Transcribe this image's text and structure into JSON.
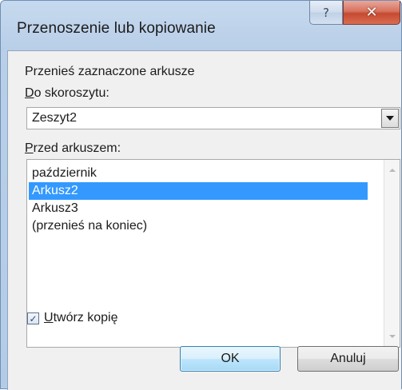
{
  "window": {
    "title": "Przenoszenie lub kopiowanie",
    "help_glyph": "?",
    "close_glyph": "✕"
  },
  "dialog": {
    "move_selected_label": "Przenieś zaznaczone arkusze",
    "to_book": {
      "label_mnemonic": "D",
      "label_rest": "o skoroszytu:",
      "value": "Zeszyt2"
    },
    "before_sheet": {
      "label_mnemonic": "P",
      "label_rest": "rzed arkuszem:",
      "items": [
        {
          "label": "październik",
          "selected": false
        },
        {
          "label": "Arkusz2",
          "selected": true
        },
        {
          "label": "Arkusz3",
          "selected": false
        },
        {
          "label": "(przenieś na koniec)",
          "selected": false
        }
      ]
    },
    "create_copy": {
      "checked": true,
      "check_glyph": "✓",
      "label_mnemonic": "U",
      "label_rest": "twórz kopię"
    },
    "ok_label": "OK",
    "cancel_label": "Anuluj"
  },
  "colors": {
    "selection": "#3399ff",
    "client_background": "#f0f0f0",
    "close_button": "#c54a32"
  }
}
